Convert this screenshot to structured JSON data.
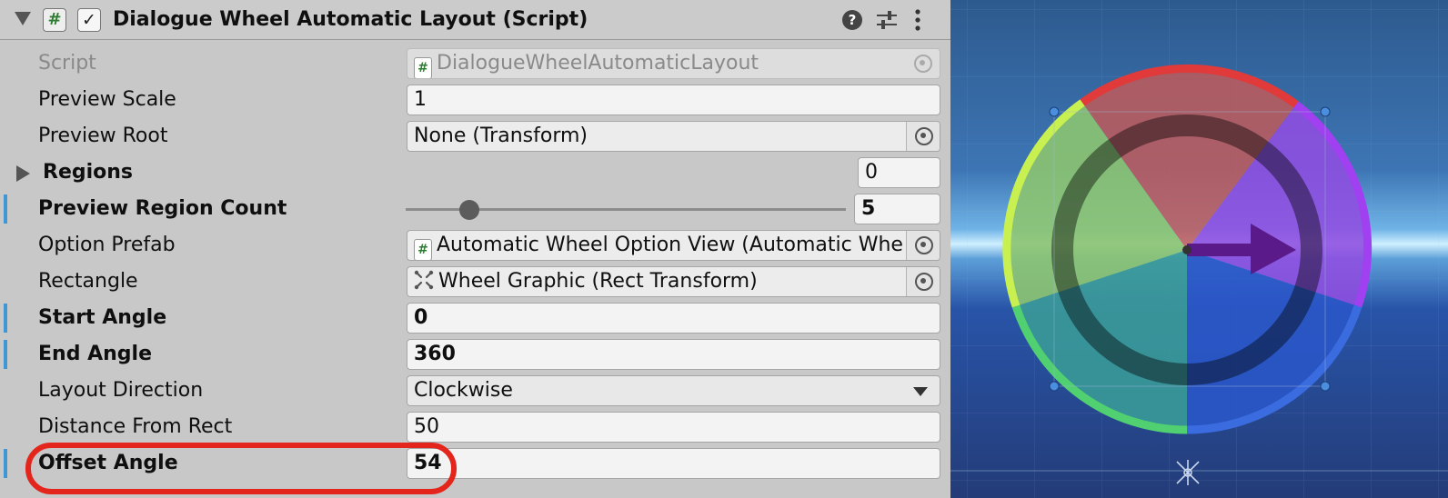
{
  "component": {
    "title": "Dialogue Wheel Automatic Layout (Script)",
    "script_icon": "#",
    "enabled_check": "✓",
    "help_symbol": "?",
    "menu_symbol": "⋮"
  },
  "properties": {
    "script": {
      "label": "Script",
      "value": "DialogueWheelAutomaticLayout"
    },
    "preview_scale": {
      "label": "Preview Scale",
      "value": "1"
    },
    "preview_root": {
      "label": "Preview Root",
      "value": "None (Transform)"
    },
    "regions": {
      "label": "Regions",
      "count": "0"
    },
    "preview_region_count": {
      "label": "Preview Region Count",
      "value": "5",
      "slider_fraction": 0.12
    },
    "option_prefab": {
      "label": "Option Prefab",
      "value": "Automatic Wheel Option View (Automatic Whe"
    },
    "rectangle": {
      "label": "Rectangle",
      "value": "Wheel Graphic (Rect Transform)"
    },
    "start_angle": {
      "label": "Start Angle",
      "value": "0"
    },
    "end_angle": {
      "label": "End Angle",
      "value": "360"
    },
    "layout_direction": {
      "label": "Layout Direction",
      "value": "Clockwise"
    },
    "distance_from_rect": {
      "label": "Distance From Rect",
      "value": "50"
    },
    "offset_angle": {
      "label": "Offset Angle",
      "value": "54"
    }
  },
  "icons": {
    "foldout": "triangle-down-icon",
    "script": "hash-icon",
    "help": "help-icon",
    "presets": "sliders-icon",
    "menu": "kebab-menu-icon",
    "object_picker": "target-icon",
    "rect_transform": "rect-transform-icon",
    "dropdown": "chevron-down-icon",
    "pivot": "pivot-icon"
  },
  "colors": {
    "modified_marker": "#3f97d6",
    "highlight": "#e3251b",
    "wheel_red": "#e03a3a",
    "wheel_purple": "#a040f0",
    "wheel_blue": "#3a6ce0",
    "wheel_green": "#50d070",
    "wheel_yellow": "#c8f050"
  }
}
